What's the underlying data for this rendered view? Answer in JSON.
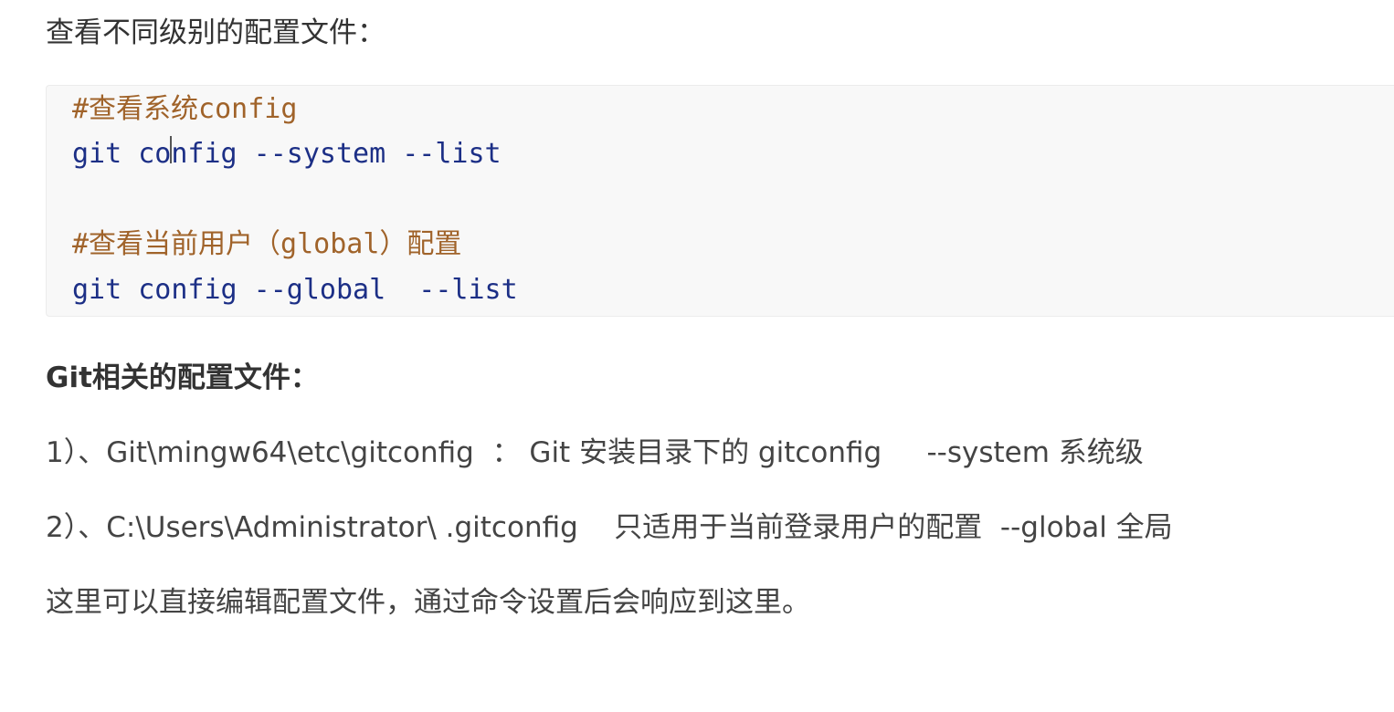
{
  "intro": "查看不同级别的配置文件：",
  "code": {
    "lines": [
      {
        "type": "comment",
        "text": "#查看系统config"
      },
      {
        "type": "command",
        "before_cursor": "git co",
        "after_cursor": "nfig --system --list"
      },
      {
        "type": "comment",
        "text": "#查看当前用户（global）配置"
      },
      {
        "type": "command",
        "text": "git config --global  --list"
      }
    ]
  },
  "section_heading": "Git相关的配置文件：",
  "items": [
    "1）、Git\\mingw64\\etc\\gitconfig  ： Git 安装目录下的 gitconfig     --system 系统级",
    "2）、C:\\Users\\Administrator\\ .gitconfig    只适用于当前登录用户的配置  --global 全局"
  ],
  "closing": "这里可以直接编辑配置文件，通过命令设置后会响应到这里。",
  "colors": {
    "comment": "#a0632a",
    "command": "#1c2f86",
    "code_background": "#f8f8f8"
  }
}
